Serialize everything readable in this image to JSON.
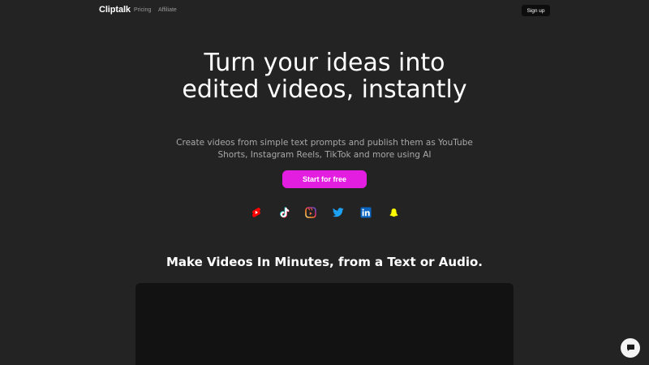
{
  "nav": {
    "logo": "Cliptalk",
    "links": [
      "Pricing",
      "Affiliate"
    ],
    "signup_label": "Sign up"
  },
  "hero": {
    "title": "Turn your ideas into edited videos, instantly",
    "subtitle": "Create videos from simple text prompts and publish them as YouTube Shorts, Instagram Reels, TikTok and more using AI",
    "cta_label": "Start for free",
    "cta_color": "#e41ee0"
  },
  "platforms": [
    {
      "icon": "youtube-shorts-icon",
      "color": "#ff0000"
    },
    {
      "icon": "tiktok-icon",
      "color": "#ffffff"
    },
    {
      "icon": "instagram-reels-icon",
      "color": "#e1306c"
    },
    {
      "icon": "twitter-icon",
      "color": "#1da1f2"
    },
    {
      "icon": "linkedin-icon",
      "color": "#0a66c2"
    },
    {
      "icon": "snapchat-icon",
      "color": "#fffc00"
    }
  ],
  "section": {
    "title": "Make Videos In Minutes, from a Text or Audio."
  },
  "chat": {
    "icon": "chat-icon"
  }
}
